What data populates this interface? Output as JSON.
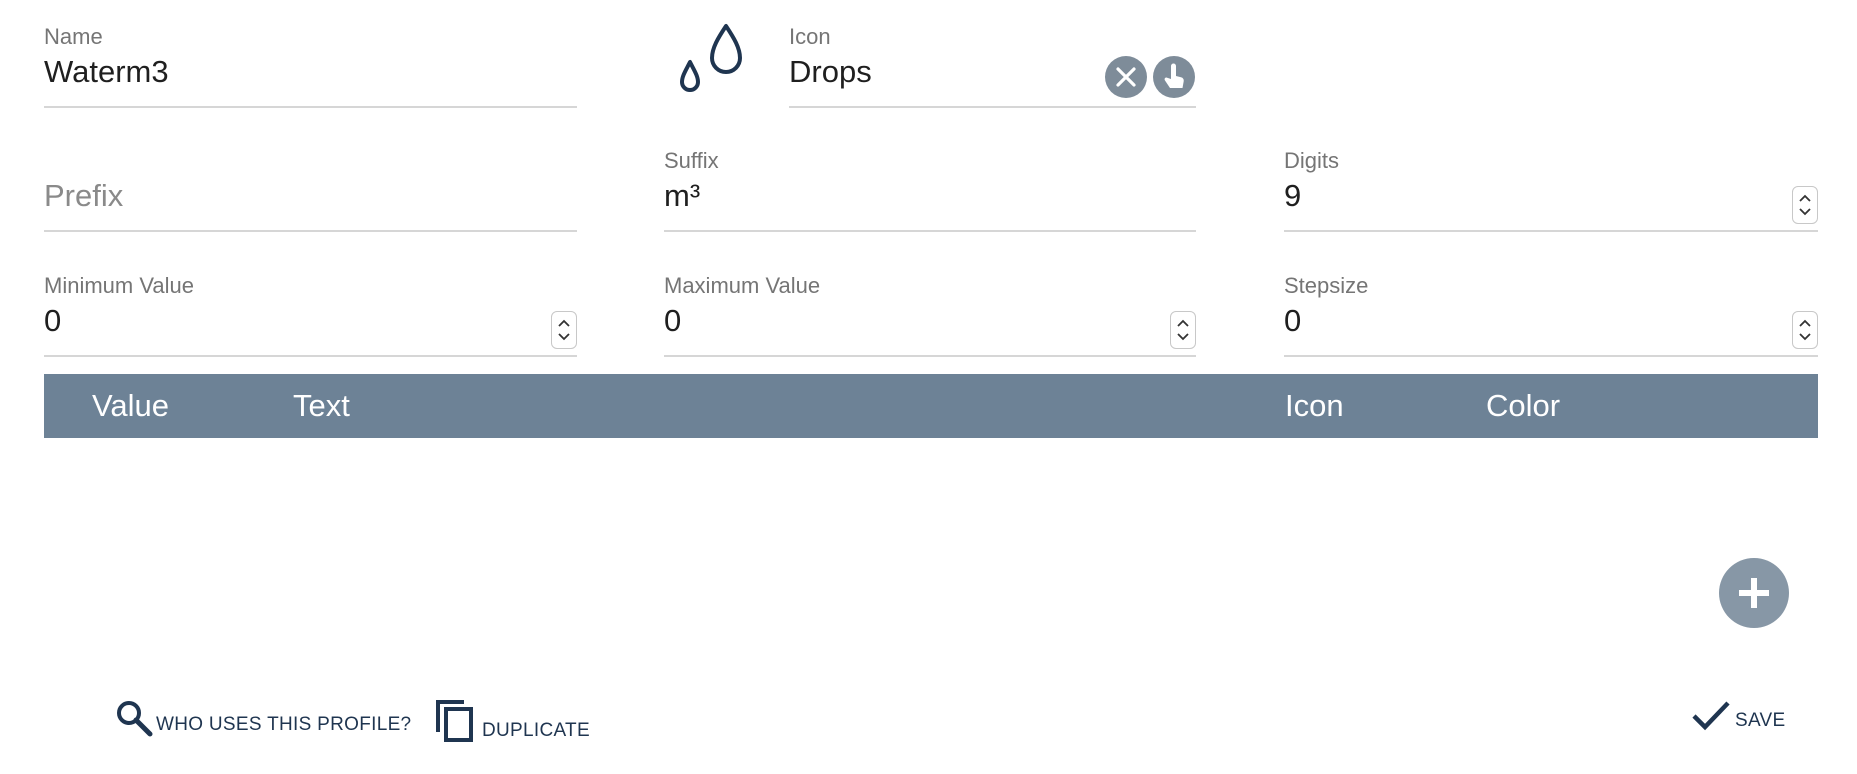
{
  "form": {
    "name": {
      "label": "Name",
      "value": "Waterm3"
    },
    "icon": {
      "label": "Icon",
      "value": "Drops",
      "preview_icon": "drops-icon",
      "clear_icon": "close-icon",
      "pick_icon": "touch-hand-icon"
    },
    "prefix": {
      "label": "",
      "placeholder": "Prefix",
      "value": ""
    },
    "suffix": {
      "label": "Suffix",
      "value": "m³"
    },
    "digits": {
      "label": "Digits",
      "value": "9"
    },
    "min_value": {
      "label": "Minimum Value",
      "value": "0"
    },
    "max_value": {
      "label": "Maximum Value",
      "value": "0"
    },
    "stepsize": {
      "label": "Stepsize",
      "value": "0"
    }
  },
  "table": {
    "columns": [
      "Value",
      "Text",
      "Icon",
      "Color"
    ],
    "rows": []
  },
  "fab": {
    "icon": "plus-icon"
  },
  "actions": {
    "who_uses": {
      "label": "WHO USES THIS PROFILE?",
      "icon": "search-icon"
    },
    "duplicate": {
      "label": "DUPLICATE",
      "icon": "copy-icon"
    },
    "save": {
      "label": "SAVE",
      "icon": "check-icon"
    }
  },
  "colors": {
    "header_bg": "#6d8296",
    "accent_dark": "#1f3550",
    "button_grey": "#7e8c99",
    "fab_grey": "#8797a6"
  }
}
